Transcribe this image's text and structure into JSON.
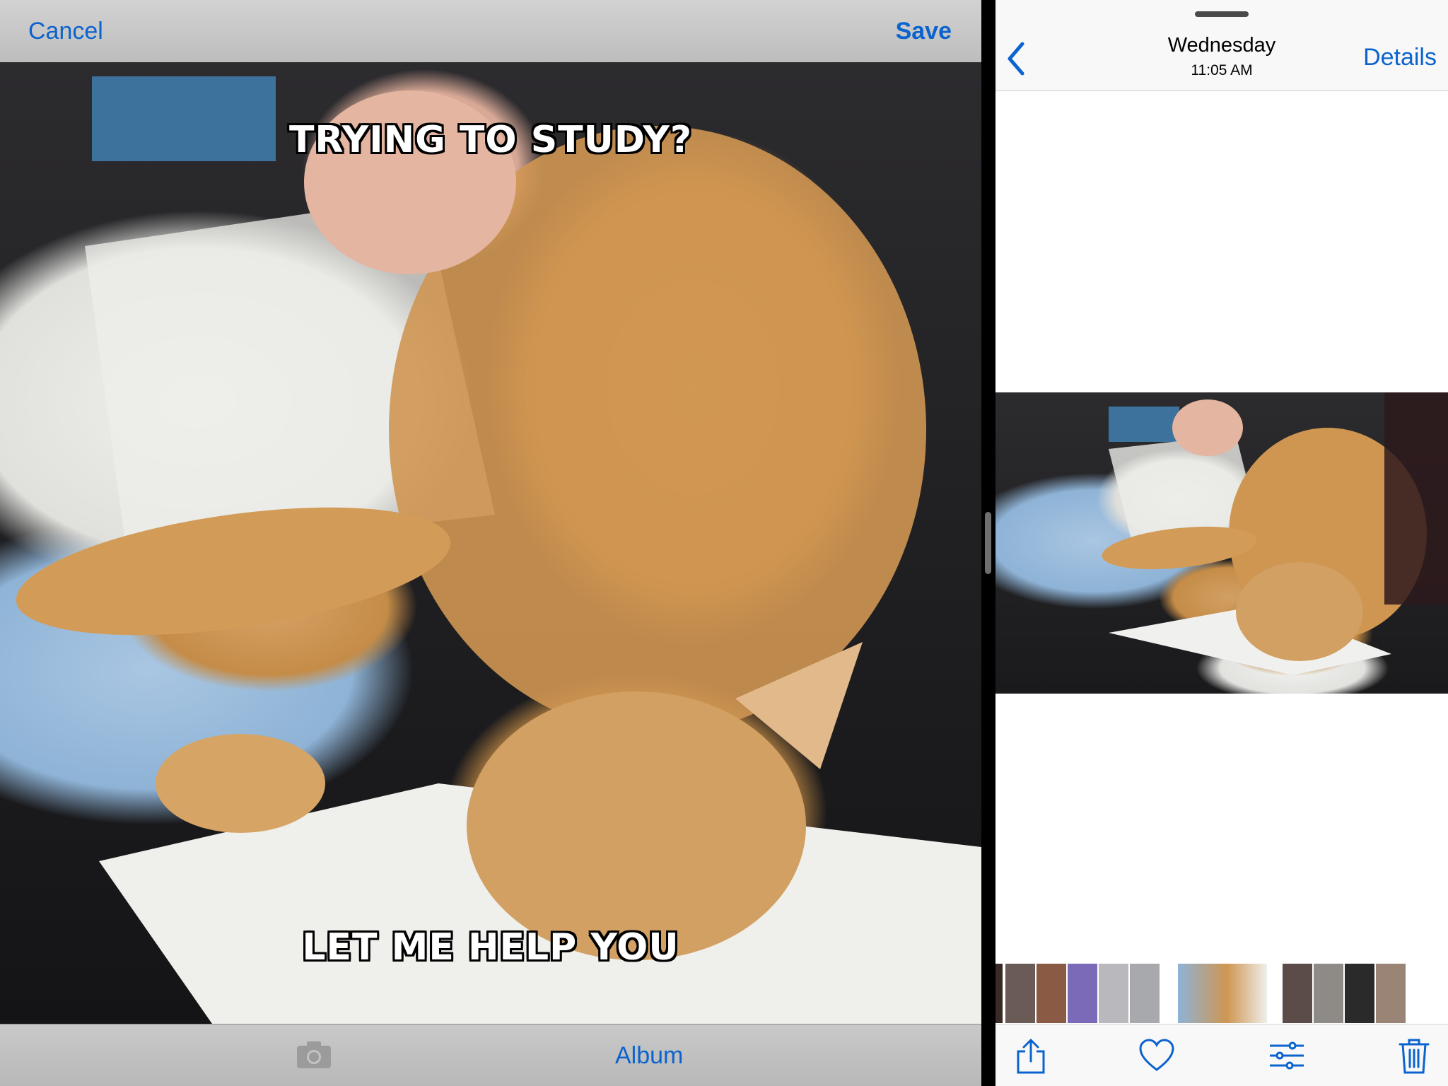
{
  "editor": {
    "top_bar": {
      "cancel_label": "Cancel",
      "save_label": "Save"
    },
    "meme": {
      "top_text": "TRYING TO STUDY?",
      "bottom_text": "LET ME HELP YOU"
    },
    "bottom_bar": {
      "camera_icon": "camera-icon",
      "album_label": "Album"
    }
  },
  "photos_app": {
    "nav": {
      "back_icon": "chevron-left-icon",
      "title": "Wednesday",
      "subtitle": "11:05 AM",
      "details_label": "Details"
    },
    "toolbar": {
      "icons": [
        "share-icon",
        "heart-icon",
        "adjust-sliders-icon",
        "trash-icon"
      ]
    }
  },
  "colors": {
    "accent": "#0b63ce"
  }
}
